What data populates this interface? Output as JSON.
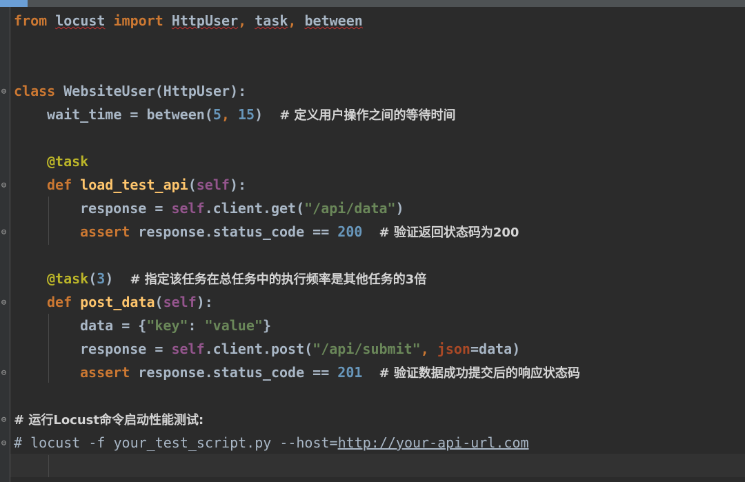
{
  "editor": {
    "lines": {
      "l1": {
        "kw1": "from",
        "mod": "locust",
        "kw2": "import",
        "rest1": "HttpUser",
        "sep1": ", ",
        "rest2": "task",
        "sep2": ", ",
        "rest3": "between"
      },
      "l4": {
        "kw": "class",
        "name": "WebsiteUser",
        "rest": "(HttpUser):"
      },
      "l5": {
        "a": "wait_time = between(",
        "n1": "5",
        "c": ", ",
        "n2": "15",
        "b": ")",
        "cmt": "# 定义用户操作之间的等待时间"
      },
      "l7": {
        "dec": "@task"
      },
      "l8": {
        "kw": "def",
        "fn": "load_test_api",
        "p1": "(",
        "self": "self",
        "p2": "):"
      },
      "l9": {
        "a": "response = ",
        "self": "self",
        "b": ".client.get(",
        "str": "\"/api/data\"",
        "c": ")"
      },
      "l10": {
        "kw": "assert",
        "a": " response.status_code == ",
        "num": "200",
        "cmt": "# 验证返回状态码为200"
      },
      "l12": {
        "dec": "@task",
        "p1": "(",
        "num": "3",
        "p2": ")",
        "cmt": "# 指定该任务在总任务中的执行频率是其他任务的3倍"
      },
      "l13": {
        "kw": "def",
        "fn": "post_data",
        "p1": "(",
        "self": "self",
        "p2": "):"
      },
      "l14": {
        "a": "data = {",
        "s1": "\"key\"",
        "b": ": ",
        "s2": "\"value\"",
        "c": "}"
      },
      "l15": {
        "a": "response = ",
        "self": "self",
        "b": ".client.post(",
        "str": "\"/api/submit\"",
        "c": ", ",
        "param": "json",
        "d": "=data)"
      },
      "l16": {
        "kw": "assert",
        "a": " response.status_code == ",
        "num": "201",
        "cmt": "# 验证数据成功提交后的响应状态码"
      },
      "l18": {
        "cmt": "# 运行Locust命令启动性能测试:"
      },
      "l19": {
        "a": "# locust -f your_test_script.py --host=",
        "url": "http://your-api-url.com"
      }
    },
    "fold_glyph_open": "⊖",
    "fold_glyph_close": "⊖"
  },
  "colors": {
    "background": "#2b2b2b",
    "keyword": "#cc7832",
    "function": "#ffc66d",
    "number": "#6897bb",
    "string": "#6a8759",
    "decorator": "#bbb529",
    "self": "#94558d"
  }
}
